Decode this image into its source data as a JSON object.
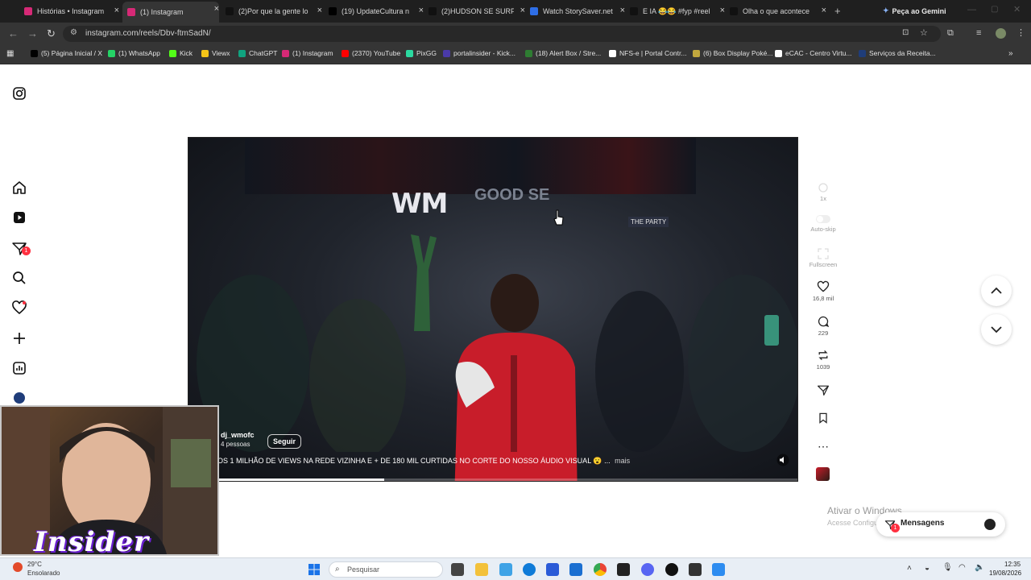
{
  "tabs": [
    {
      "label": "Histórias • Instagram",
      "color": "#d62976"
    },
    {
      "label": "(1) Instagram",
      "color": "#d62976",
      "active": true
    },
    {
      "label": "(2)Por que la gente lo",
      "color": "#111111"
    },
    {
      "label": "(19) UpdateCultura n",
      "color": "#000000"
    },
    {
      "label": "(2)HUDSON SE SURP",
      "color": "#111111"
    },
    {
      "label": "Watch StorySaver.net",
      "color": "#2e6ee6"
    },
    {
      "label": "E IA 😂😂 #fyp #reel",
      "color": "#111111"
    },
    {
      "label": "Olha o que acontece",
      "color": "#111111"
    }
  ],
  "gemini_label": "Peça ao Gemini",
  "url": "instagram.com/reels/Dbv-ftmSadN/",
  "bookmarks": [
    "(5) Página Inicial / X",
    "(1) WhatsApp",
    "Kick",
    "Viewx",
    "ChatGPT",
    "(1) Instagram",
    "(2370) YouTube",
    "PixGG",
    "portalinsider - Kick...",
    "(18) Alert Box / Stre...",
    "NFS-e | Portal Contr...",
    "(6) Box Display Poké...",
    "eCAC - Centro Virtu...",
    "Serviços da Receita..."
  ],
  "sidebar": {
    "notifications_badge": "1"
  },
  "video": {
    "logo_text": "WM",
    "logo_text2": "GOOD SE",
    "tag_right": "THE PARTY",
    "author": "dj_wmofc",
    "people": "4 pessoas",
    "follow": "Seguir",
    "caption": "OS 1 MILHÃO DE VIEWS NA REDE VIZINHA E + DE 180 MIL CURTIDAS NO CORTE DO NOSSO ÁUDIO VISUAL 😮 ...",
    "more": "mais",
    "progress": 0.32
  },
  "actions": {
    "speed": "1x",
    "autoskip": "Auto-skip",
    "fullscreen": "Fullscreen",
    "likes": "16,8 mil",
    "comments": "229",
    "reposts": "1039"
  },
  "overlay": {
    "activate_title": "Ativar o Windows",
    "activate_sub": "Acesse Configurações",
    "messages": "Mensagens",
    "messages_badge": "1",
    "webcam_brand": "Insider"
  },
  "taskbar": {
    "temp": "29°C",
    "weather": "Ensolarado",
    "search": "Pesquisar",
    "time": "12:35",
    "date": "19/08/2026"
  }
}
